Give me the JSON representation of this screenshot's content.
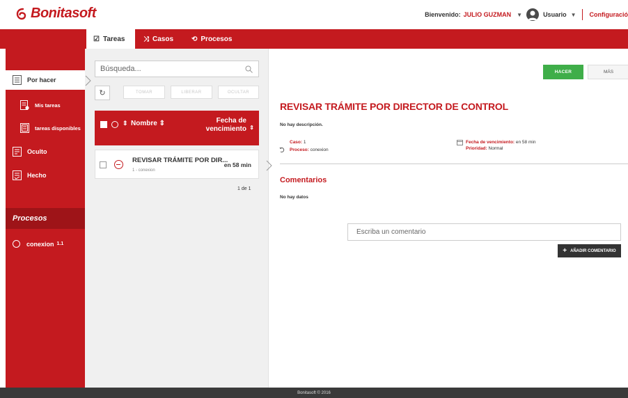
{
  "header": {
    "logo_text": "Bonitasoft",
    "welcome_label": "Bienvenido:",
    "user_name": "JULIO GUZMAN",
    "user_role": "Usuario",
    "config_label": "Configuració"
  },
  "tabs": [
    {
      "label": "Tareas",
      "icon": "checkbox-icon",
      "active": true
    },
    {
      "label": "Casos",
      "icon": "shuffle-icon",
      "active": false
    },
    {
      "label": "Procesos",
      "icon": "process-icon",
      "active": false
    }
  ],
  "sidebar": {
    "items": [
      {
        "label": "Por hacer",
        "icon": "inbox-icon",
        "active": true
      },
      {
        "label": "Mis tareas",
        "icon": "my-tasks-icon",
        "active": false
      },
      {
        "label": "tareas disponibles",
        "icon": "available-tasks-icon",
        "active": false
      },
      {
        "label": "Oculto",
        "icon": "hidden-icon",
        "active": false
      },
      {
        "label": "Hecho",
        "icon": "done-icon",
        "active": false
      }
    ],
    "processes_title": "Procesos",
    "processes": [
      {
        "name": "conexion",
        "version": "1.1"
      }
    ]
  },
  "task_list": {
    "search_placeholder": "Búsqueda...",
    "actions": [
      "TOMAR",
      "LIBERAR",
      "OCULTAR"
    ],
    "columns": {
      "name": "Nombre",
      "due_line1": "Fecha de",
      "due_line2": "vencimiento"
    },
    "tasks": [
      {
        "title": "REVISAR TRÁMITE POR DIR...",
        "subtitle": "1 - conexion",
        "due": "en 58 min"
      }
    ],
    "pager": "1 de 1"
  },
  "detail": {
    "do_button": "HACER",
    "more_button": "MÁS",
    "title": "REVISAR TRÁMITE POR DIRECTOR DE CONTROL",
    "description": "No hay descripción.",
    "case_label": "Caso:",
    "case_value": "1",
    "process_label": "Proceso:",
    "process_value": "conexion",
    "due_label": "Fecha de vencimiento:",
    "due_value": "en 58 min",
    "priority_label": "Prioridad:",
    "priority_value": "Normal",
    "comments_title": "Comentarios",
    "no_data": "No hay datos",
    "comment_placeholder": "Escriba un comentario",
    "add_comment_button": "AÑADIR COMENTARIO"
  },
  "footer": {
    "text": "Bonitasoft © 2016"
  },
  "colors": {
    "brand": "#c41a1f",
    "brand_dark": "#9e1418",
    "action_green": "#3fae49",
    "footer": "#3a3a3a"
  }
}
